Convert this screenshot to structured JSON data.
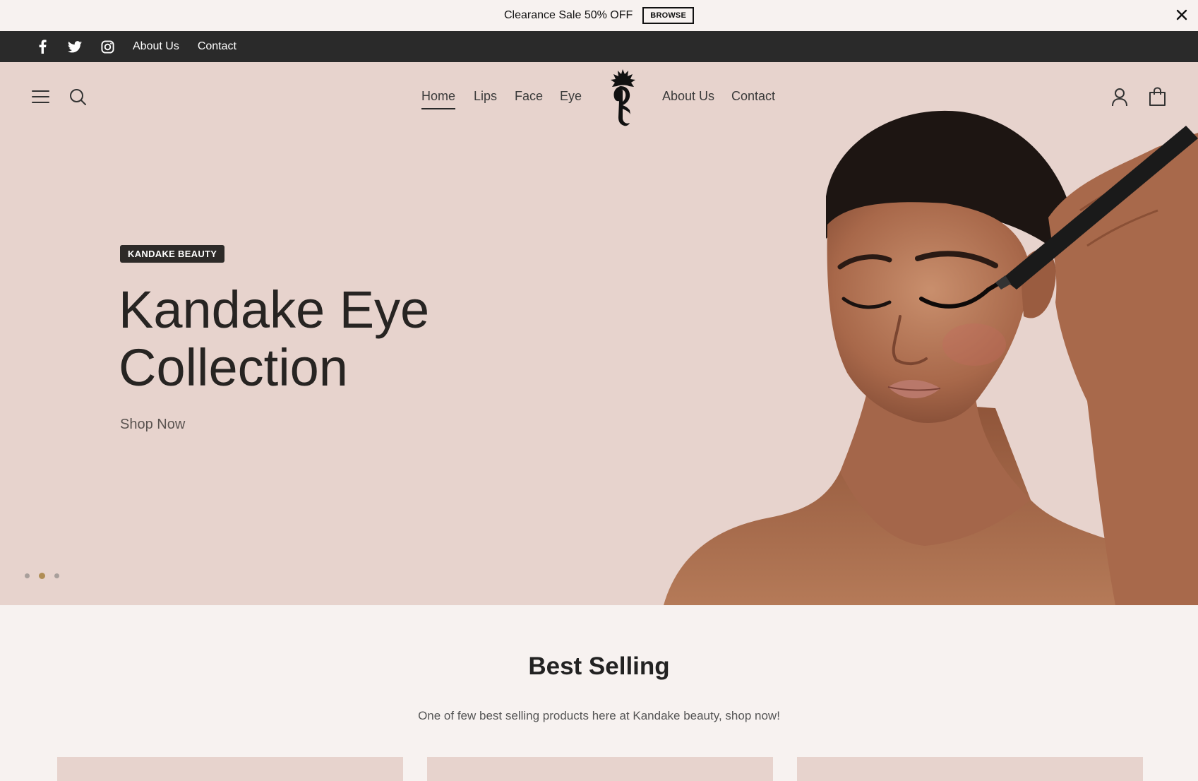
{
  "announcement": {
    "text": "Clearance Sale 50% OFF",
    "button_label": "BROWSE",
    "close_icon": "close-icon"
  },
  "topbar": {
    "social_icons": [
      "facebook-icon",
      "twitter-icon",
      "instagram-icon"
    ],
    "links": [
      {
        "label": "About Us"
      },
      {
        "label": "Contact"
      }
    ]
  },
  "header": {
    "left_icons": [
      "menu-icon",
      "search-icon"
    ],
    "nav_left": [
      {
        "label": "Home",
        "active": true
      },
      {
        "label": "Lips"
      },
      {
        "label": "Face"
      },
      {
        "label": "Eye"
      }
    ],
    "nav_right": [
      {
        "label": "About Us"
      },
      {
        "label": "Contact"
      }
    ],
    "right_icons": [
      "account-icon",
      "cart-icon"
    ]
  },
  "hero": {
    "badge": "KANDAKE BEAUTY",
    "title_line1": "Kandake Eye",
    "title_line2": "Collection",
    "cta": "Shop Now",
    "slides_total": 3,
    "active_slide": 2
  },
  "best_selling": {
    "title": "Best Selling",
    "subtitle": "One of few best selling products here at Kandake beauty, shop now!"
  },
  "colors": {
    "hero_bg": "#e7d3cd",
    "page_bg": "#f7f2f0",
    "topbar_bg": "#2a2a2a",
    "dot_active": "#b08d55"
  }
}
